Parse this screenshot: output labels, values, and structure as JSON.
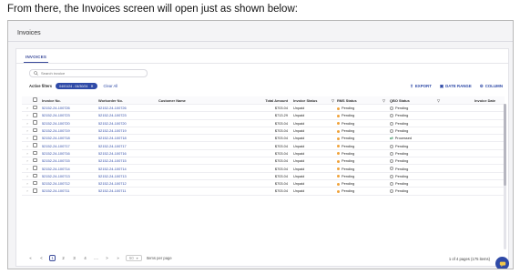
{
  "caption": "From there, the Invoices screen will open just as shown below:",
  "window_title": "Invoices",
  "tab": "INVOICES",
  "search": {
    "placeholder": "Search invoice"
  },
  "filters": {
    "label": "Active filters",
    "chip": "04/01/24 - 04/30/24",
    "clear": "Clear All"
  },
  "actions": {
    "export": "EXPORT",
    "date_range": "DATE RANGE",
    "column": "COLUMN"
  },
  "columns": {
    "invoice_no": "Invoice No.",
    "workorder_no": "Workorder No.",
    "customer": "Customer Name",
    "total": "Total Amount",
    "invoice_status": "Invoice Status",
    "rms_status": "RMS Status",
    "qbo_status": "QBO Status",
    "invoice_date": "Invoice Date"
  },
  "rows": [
    {
      "invoice": "52152-24-100726",
      "workorder": "52152-24-100726",
      "amount": "$703.04",
      "status": "Unpaid",
      "rms": "Pending",
      "qbo": "Pending"
    },
    {
      "invoice": "52152-24-100723",
      "workorder": "52152-24-100723",
      "amount": "$713.29",
      "status": "Unpaid",
      "rms": "Pending",
      "qbo": "Pending"
    },
    {
      "invoice": "52152-24-100720",
      "workorder": "52152-24-100720",
      "amount": "$703.04",
      "status": "Unpaid",
      "rms": "Pending",
      "qbo": "Pending"
    },
    {
      "invoice": "52152-24-100719",
      "workorder": "52152-24-100719",
      "amount": "$703.04",
      "status": "Unpaid",
      "rms": "Pending",
      "qbo": "Pending"
    },
    {
      "invoice": "52152-24-100718",
      "workorder": "52152-24-100718",
      "amount": "$703.04",
      "status": "Unpaid",
      "rms": "Pending",
      "qbo": "Processed"
    },
    {
      "invoice": "52152-24-100717",
      "workorder": "52152-24-100717",
      "amount": "$703.04",
      "status": "Unpaid",
      "rms": "Pending",
      "qbo": "Pending"
    },
    {
      "invoice": "52152-24-100716",
      "workorder": "52152-24-100716",
      "amount": "$703.04",
      "status": "Unpaid",
      "rms": "Pending",
      "qbo": "Pending"
    },
    {
      "invoice": "52152-24-100715",
      "workorder": "52152-24-100715",
      "amount": "$703.04",
      "status": "Unpaid",
      "rms": "Pending",
      "qbo": "Pending"
    },
    {
      "invoice": "52152-24-100714",
      "workorder": "52152-24-100714",
      "amount": "$703.04",
      "status": "Unpaid",
      "rms": "Pending",
      "qbo": "Pending"
    },
    {
      "invoice": "52152-24-100713",
      "workorder": "52152-24-100713",
      "amount": "$703.04",
      "status": "Unpaid",
      "rms": "Pending",
      "qbo": "Pending"
    },
    {
      "invoice": "52152-24-100712",
      "workorder": "52152-24-100712",
      "amount": "$703.04",
      "status": "Unpaid",
      "rms": "Pending",
      "qbo": "Pending"
    },
    {
      "invoice": "52152-24-100711",
      "workorder": "52152-24-100711",
      "amount": "$703.04",
      "status": "Unpaid",
      "rms": "Pending",
      "qbo": "Pending"
    }
  ],
  "pagination": {
    "pages": [
      "1",
      "2",
      "3",
      "4",
      "....",
      ">",
      "»"
    ],
    "prev": [
      "«",
      "<"
    ],
    "per_page_value": "50",
    "per_page_label": "Items per page",
    "info": "1 of 4 pages (175 items)"
  },
  "colors": {
    "accent": "#2f4aa7",
    "pending_dot": "#f0a23a",
    "processed": "#2e8b57"
  }
}
